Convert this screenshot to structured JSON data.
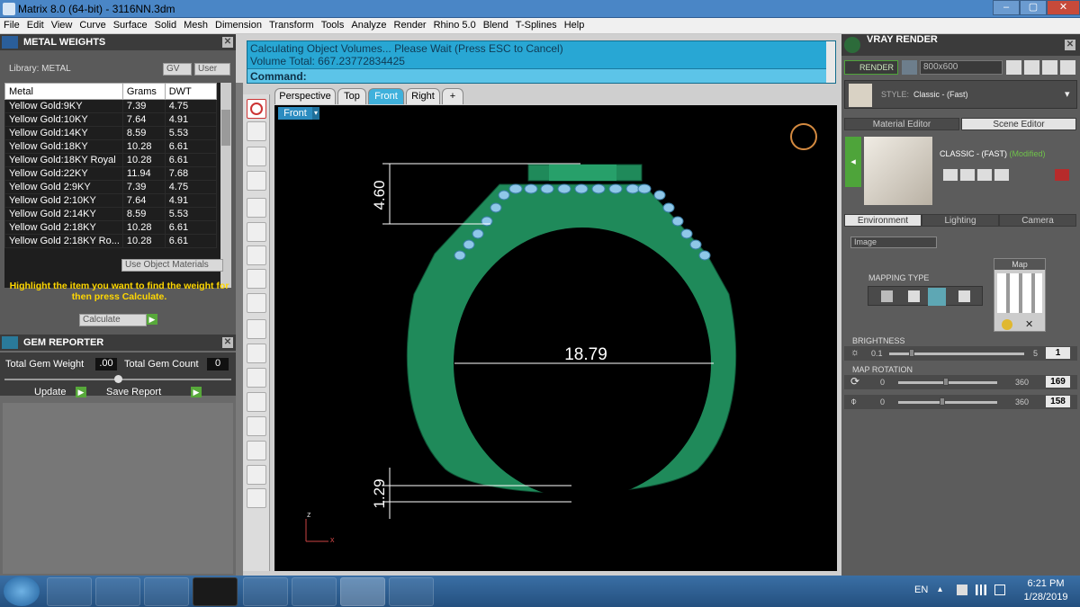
{
  "window": {
    "title": "Matrix 8.0 (64-bit) - 3116NN.3dm",
    "min": "–",
    "max": "▢",
    "close": "✕"
  },
  "menu": [
    "File",
    "Edit",
    "View",
    "Curve",
    "Surface",
    "Solid",
    "Mesh",
    "Dimension",
    "Transform",
    "Tools",
    "Analyze",
    "Render",
    "Rhino 5.0",
    "Blend",
    "T-Splines",
    "Help"
  ],
  "metal": {
    "title": "METAL WEIGHTS",
    "library_label": "Library: METAL",
    "gv": "GV",
    "user": "User",
    "columns": [
      "Metal",
      "Grams",
      "DWT"
    ],
    "rows": [
      [
        "Yellow Gold:9KY",
        "7.39",
        "4.75"
      ],
      [
        "Yellow Gold:10KY",
        "7.64",
        "4.91"
      ],
      [
        "Yellow Gold:14KY",
        "8.59",
        "5.53"
      ],
      [
        "Yellow Gold:18KY",
        "10.28",
        "6.61"
      ],
      [
        "Yellow Gold:18KY Royal",
        "10.28",
        "6.61"
      ],
      [
        "Yellow Gold:22KY",
        "11.94",
        "7.68"
      ],
      [
        "Yellow Gold 2:9KY",
        "7.39",
        "4.75"
      ],
      [
        "Yellow Gold 2:10KY",
        "7.64",
        "4.91"
      ],
      [
        "Yellow Gold 2:14KY",
        "8.59",
        "5.53"
      ],
      [
        "Yellow Gold 2:18KY",
        "10.28",
        "6.61"
      ],
      [
        "Yellow Gold 2:18KY Ro...",
        "10.28",
        "6.61"
      ]
    ],
    "use_object_materials": "Use Object Materials",
    "hint": "Highlight the item you want to find the weight for then press Calculate.",
    "calculate": "Calculate"
  },
  "gem": {
    "title": "GEM REPORTER",
    "total_weight_label": "Total Gem Weight",
    "total_weight": ".00",
    "total_count_label": "Total Gem Count",
    "total_count": "0",
    "update": "Update",
    "save_report": "Save Report"
  },
  "command": {
    "line1": "Calculating Object Volumes... Please Wait (Press ESC to Cancel)",
    "line2": "Volume Total: 667.23772834425",
    "prompt": "Command:"
  },
  "viewtabs": [
    "Perspective",
    "Top",
    "Front",
    "Right",
    "+"
  ],
  "active_view": "Front",
  "viewport": {
    "label": "Front",
    "dims": {
      "inner": "18.79",
      "top": "4.60",
      "bottom": "1.29"
    },
    "axis_z": "z",
    "axis_x": "x"
  },
  "vray": {
    "title": "VRAY RENDER",
    "render": "RENDER",
    "resolution": "800x600",
    "style_label": "STYLE:",
    "style_value": "Classic - (Fast)",
    "tabs": [
      "Material Editor",
      "Scene Editor"
    ],
    "preset_name": "CLASSIC - (FAST)",
    "preset_modified": "(Modified)",
    "subtabs": [
      "Environment",
      "Lighting",
      "Camera"
    ],
    "env_type": "Image",
    "mapping_type": "MAPPING TYPE",
    "map_label": "Map",
    "brightness_label": "BRIGHTNESS",
    "brightness_min": "0.1",
    "brightness_max": "5",
    "brightness_value": "1",
    "map_rotation_label": "MAP ROTATION",
    "rot1_min": "0",
    "rot1_max": "360",
    "rot1_value": "169",
    "rot2_min": "0",
    "rot2_max": "360",
    "rot2_value": "158"
  },
  "taskbar": {
    "lang": "EN",
    "time": "6:21 PM",
    "date": "1/28/2019"
  },
  "colors": {
    "ring": "#1f8a5a",
    "stone": "#8fc7e8",
    "command_bg": "#28a7d4"
  }
}
